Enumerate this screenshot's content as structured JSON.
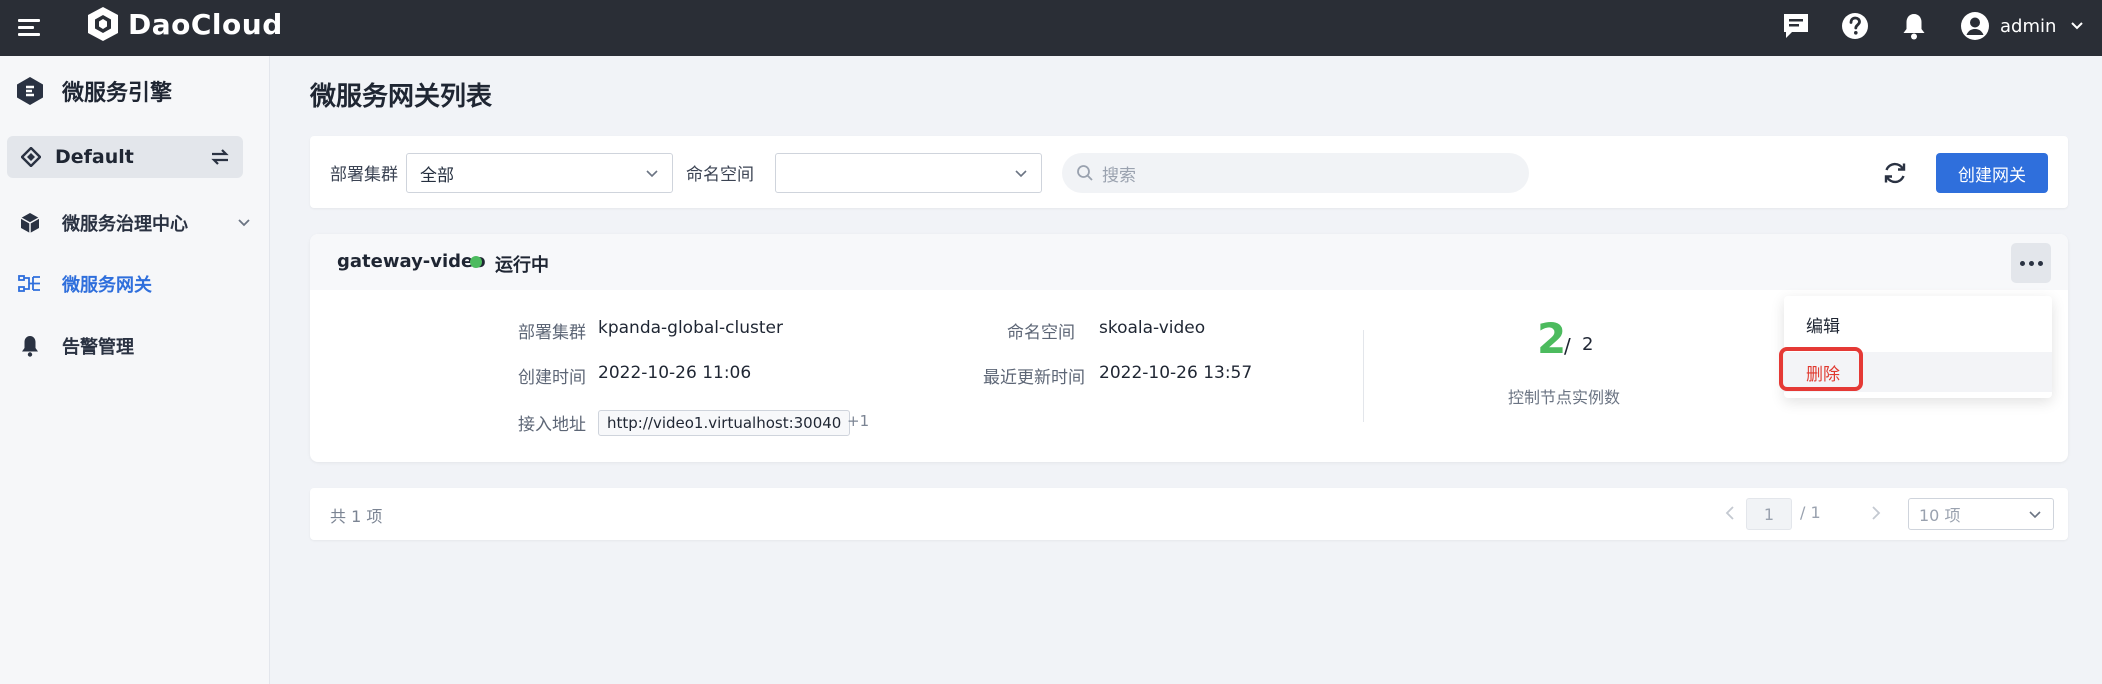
{
  "topbar": {
    "brand": "DaoCloud",
    "username": "admin",
    "icons": [
      "menu-icon",
      "daocloud-logo-icon",
      "message-icon",
      "help-icon",
      "bell-icon",
      "user-avatar-icon",
      "chevron-down-icon"
    ]
  },
  "sidebar": {
    "title": "微服务引擎",
    "workspace": "Default",
    "items": [
      {
        "label": "微服务治理中心",
        "icon": "cube-icon",
        "expandable": true
      },
      {
        "label": "微服务网关",
        "icon": "gateway-icon",
        "active": true
      },
      {
        "label": "告警管理",
        "icon": "bell-icon"
      }
    ]
  },
  "page": {
    "title": "微服务网关列表"
  },
  "filters": {
    "cluster_label": "部署集群",
    "cluster_value": "全部",
    "namespace_label": "命名空间",
    "namespace_value": "",
    "search_placeholder": "搜索",
    "create_button": "创建网关"
  },
  "gateway": {
    "name": "gateway-video",
    "status": "运行中",
    "status_color": "#4cbb5e",
    "fields": {
      "cluster_label": "部署集群",
      "cluster_value": "kpanda-global-cluster",
      "namespace_label": "命名空间",
      "namespace_value": "skoala-video",
      "created_label": "创建时间",
      "created_value": "2022-10-26 11:06",
      "updated_label": "最近更新时间",
      "updated_value": "2022-10-26 13:57",
      "address_label": "接入地址",
      "address_value": "http://video1.virtualhost:30040",
      "address_more": "+1"
    },
    "instances_running": "2",
    "instances_sep": "/",
    "instances_total": "2",
    "instances_label": "控制节点实例数"
  },
  "dropdown": {
    "edit": "编辑",
    "delete": "删除"
  },
  "pagination": {
    "total": "共 1 项",
    "current_page": "1",
    "page_count": "/ 1",
    "page_size": "10 项"
  },
  "colors": {
    "accent": "#2f6fdc",
    "topbar": "#2a2e36",
    "danger": "#e0392f",
    "highlight": "#e53935"
  }
}
